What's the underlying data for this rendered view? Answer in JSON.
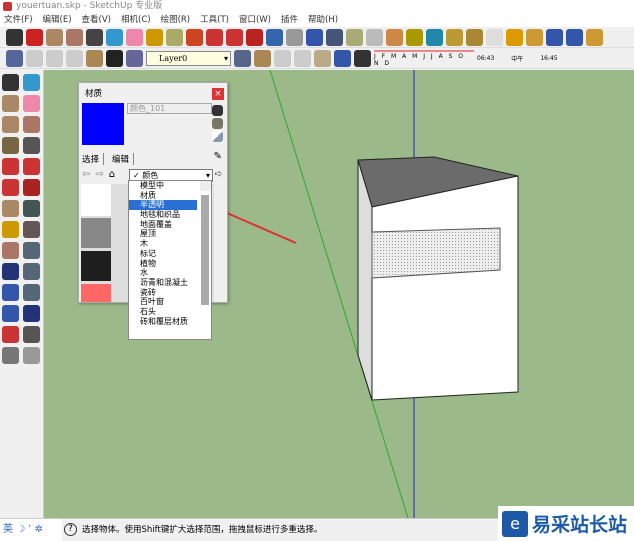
{
  "window": {
    "title": "youertuan.skp - SketchUp 专业版"
  },
  "menu": [
    "文件(F)",
    "编辑(E)",
    "查看(V)",
    "相机(C)",
    "绘图(R)",
    "工具(T)",
    "窗口(W)",
    "插件",
    "帮助(H)"
  ],
  "toolbar": {
    "layer": "Layer0",
    "months": "J F M A M J J A S O N D",
    "time_start": "06:43",
    "time_mid": "中午",
    "time_end": "16:45"
  },
  "materials": {
    "title": "材质",
    "close": "×",
    "name": "颜色_101",
    "swatch_color": "#0000ff",
    "tabs": [
      "选择",
      "编辑"
    ],
    "category": "颜色",
    "dropdown": [
      "模型中",
      "材质",
      "半透明",
      "地毯和织品",
      "地面覆盖",
      "屋顶",
      "木",
      "标记",
      "植物",
      "水",
      "沥青和混凝土",
      "瓷砖",
      "百叶窗",
      "石头",
      "砖和覆层材质"
    ],
    "selected": "半透明"
  },
  "status": {
    "ime": "英",
    "text": "选择物体。使用Shift键扩大选择范围，拖拽鼠标进行多重选择。"
  },
  "watermark": {
    "text": "易采站长站"
  }
}
